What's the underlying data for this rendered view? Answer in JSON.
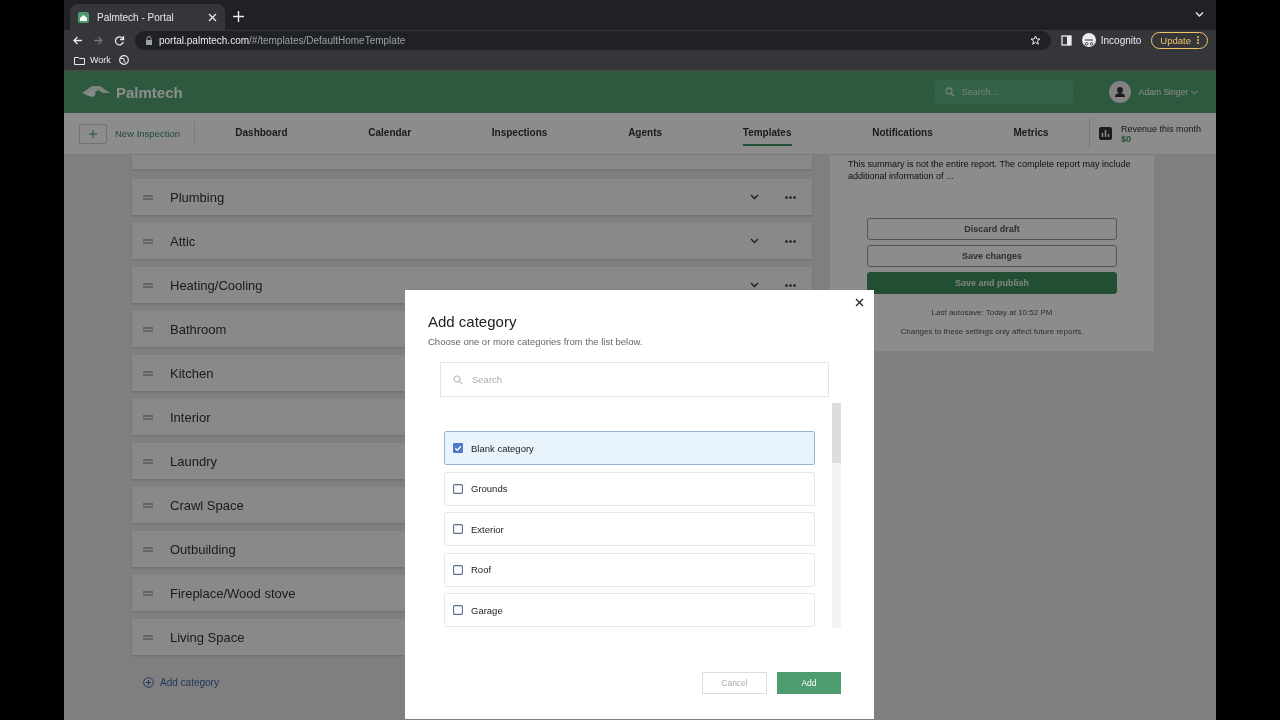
{
  "browser": {
    "tab_title": "Palmtech - Portal",
    "address_host": "portal.palmtech.com",
    "address_path": "/#/templates/DefaultHomeTemplate",
    "profile": "Incognito",
    "update": "Update",
    "bookmarks": [
      {
        "label": "Work"
      }
    ]
  },
  "header": {
    "logo": "Palmtech",
    "search_placeholder": "Search...",
    "user": "Adam Singer"
  },
  "nav": {
    "new_inspection": "New Inspection",
    "tabs": [
      {
        "label": "Dashboard",
        "selected": false
      },
      {
        "label": "Calendar",
        "selected": false
      },
      {
        "label": "Inspections",
        "selected": false
      },
      {
        "label": "Agents",
        "selected": false
      },
      {
        "label": "Templates",
        "selected": true
      },
      {
        "label": "Notifications",
        "selected": false
      },
      {
        "label": "Metrics",
        "selected": false
      }
    ],
    "revenue_label": "Revenue this month",
    "revenue_value": "$0"
  },
  "categories": [
    "Plumbing",
    "Attic",
    "Heating/Cooling",
    "Bathroom",
    "Kitchen",
    "Interior",
    "Laundry",
    "Crawl Space",
    "Outbuilding",
    "Fireplace/Wood stove",
    "Living Space"
  ],
  "add_category": "Add category",
  "summary": {
    "text": "This summary is not the entire report. The complete report may include additional information of ...",
    "buttons": [
      {
        "label": "Discard draft",
        "kind": "outline"
      },
      {
        "label": "Save changes",
        "kind": "outline"
      },
      {
        "label": "Save and publish",
        "kind": "primary"
      }
    ],
    "autosave": "Last autosave: Today at 10:52 PM",
    "note": "Changes to these settings only affect future reports."
  },
  "modal": {
    "title": "Add category",
    "subtitle": "Choose one or more categories from the list below.",
    "search_placeholder": "Search",
    "items": [
      {
        "label": "Blank category",
        "checked": true
      },
      {
        "label": "Grounds",
        "checked": false
      },
      {
        "label": "Exterior",
        "checked": false
      },
      {
        "label": "Roof",
        "checked": false
      },
      {
        "label": "Garage",
        "checked": false
      }
    ],
    "cancel": "Cancel",
    "add": "Add"
  }
}
